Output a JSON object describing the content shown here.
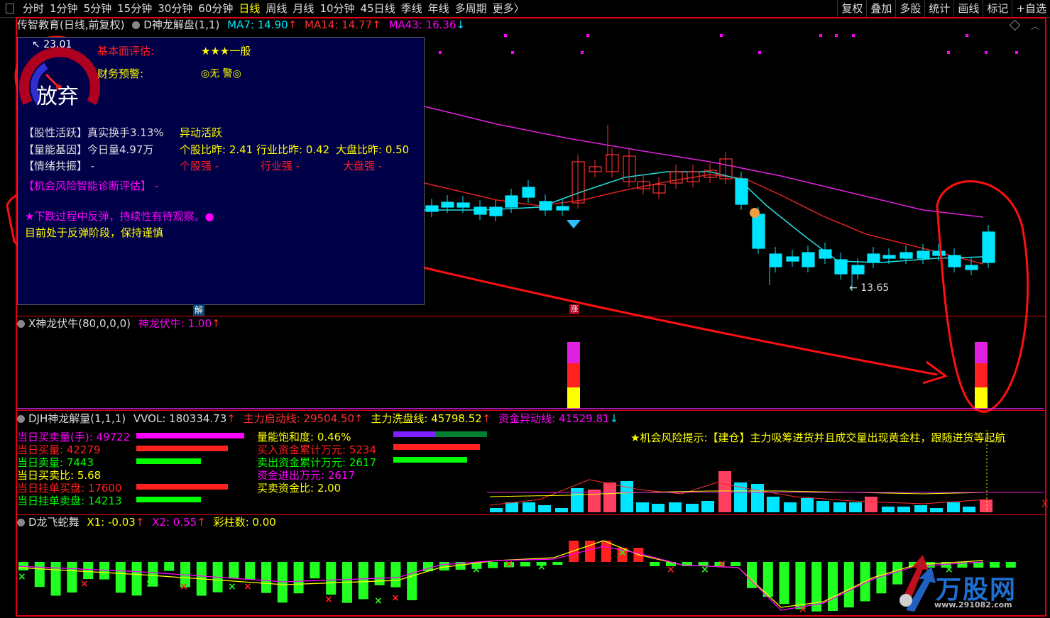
{
  "toolbar": {
    "periods": [
      "分时",
      "1分钟",
      "5分钟",
      "15分钟",
      "30分钟",
      "60分钟",
      "日线",
      "周线",
      "月线",
      "10分钟",
      "45日线",
      "季线",
      "年线",
      "多周期",
      "更多〉"
    ],
    "active": "日线",
    "right": [
      "复权",
      "叠加",
      "多股",
      "统计",
      "画线",
      "标记",
      "+自选"
    ]
  },
  "main_header": {
    "stock": "传智教育(日线,前复权)",
    "indicator": "D神龙解盘(1,1)",
    "ma7": "MA7: 14.90",
    "ma14": "MA14: 14.77",
    "ma43": "MA43: 16.36",
    "up_arrow": "↑",
    "down_arrow": "↓",
    "high_label": "23.01",
    "low_label": "13.65"
  },
  "gauge": {
    "text": "放弃"
  },
  "info": {
    "fund_label": "基本面评估:",
    "fund_value": "★★★一般",
    "warn_label": "财务预警:",
    "warn_value": "◎无 警◎",
    "active_label": "【股性活跃】真实换手3.13%",
    "active_value": "异动活跃",
    "energy_label": "【量能基因】今日量4.97万",
    "energy_stock": "个股比昨: 2.41",
    "energy_industry": "行业比昨: 0.42",
    "energy_market": "大盘比昨: 0.50",
    "mood_label": "【情绪共振】 -",
    "mood_stock": "个股强 -",
    "mood_industry": "行业强 -",
    "mood_market": "大盘强 -",
    "diag_label": "【机会风险智能诊断评估】 -",
    "diag_line1": "★下跌过程中反弹，持续性有待观察。●",
    "diag_line2": "目前处于反弹阶段，保持谨慎"
  },
  "markers": {
    "jie": "解",
    "zhang": "涨"
  },
  "panel2": {
    "title": "X神龙伏牛(80,0,0,0)",
    "value": "神龙伏牛: 1.00",
    "arrow": "↑"
  },
  "panel3": {
    "title": "DJH神龙解量(1,1,1)",
    "vvol": "VVOL: 180334.73",
    "start_line": "主力启动线: 29504.50",
    "wash_line": "主力洗盘线: 45798.52",
    "abnormal_line": "资金异动线: 41529.81",
    "up": "↑",
    "down": "↓",
    "stats_left": [
      {
        "text": "当日买卖量(手):  49722",
        "color": "#ff00ff"
      },
      {
        "text": "当日买量:  42279",
        "color": "#ff2020"
      },
      {
        "text": "当日卖量:  7443",
        "color": "#00ff00"
      },
      {
        "text": "当日买卖比:  5.68",
        "color": "#ffff00"
      },
      {
        "text": "当日挂单买盘:  17600",
        "color": "#ff2020"
      },
      {
        "text": "当日挂单卖盘:  14213",
        "color": "#00ff00"
      }
    ],
    "stats_left_bars": [
      {
        "frac": 1.0,
        "color": "#ff00ff"
      },
      {
        "frac": 0.85,
        "color": "#ff2020"
      },
      {
        "frac": 0.6,
        "color": "#00ff00"
      },
      {
        "frac": 0,
        "color": "#000"
      },
      {
        "frac": 0.85,
        "color": "#ff2020"
      },
      {
        "frac": 0.6,
        "color": "#00ff00"
      }
    ],
    "stats_right": [
      {
        "text": "量能饱和度:   0.46%",
        "color": "#ffff00"
      },
      {
        "text": "买入资金累计万元: 5234",
        "color": "#ff2020"
      },
      {
        "text": "卖出资金累计万元: 2617",
        "color": "#00ff00"
      },
      {
        "text": "资金进出万元: 2617",
        "color": "#ff00ff"
      },
      {
        "text": "买卖资金比: 2.00",
        "color": "#ffff00"
      }
    ],
    "hint": "★机会风险提示:【建仓】主力吸筹进货并且成交量出现黄金柱，跟随进货等起航",
    "axis_x": "X"
  },
  "panel4": {
    "title": "D龙飞蛇舞",
    "x1": "X1: -0.03",
    "x2": "X2: 0.55",
    "bars": "彩柱数: 0.00",
    "up": "↑"
  },
  "watermark": {
    "name": "万股网",
    "url": "www.291082.com"
  }
}
